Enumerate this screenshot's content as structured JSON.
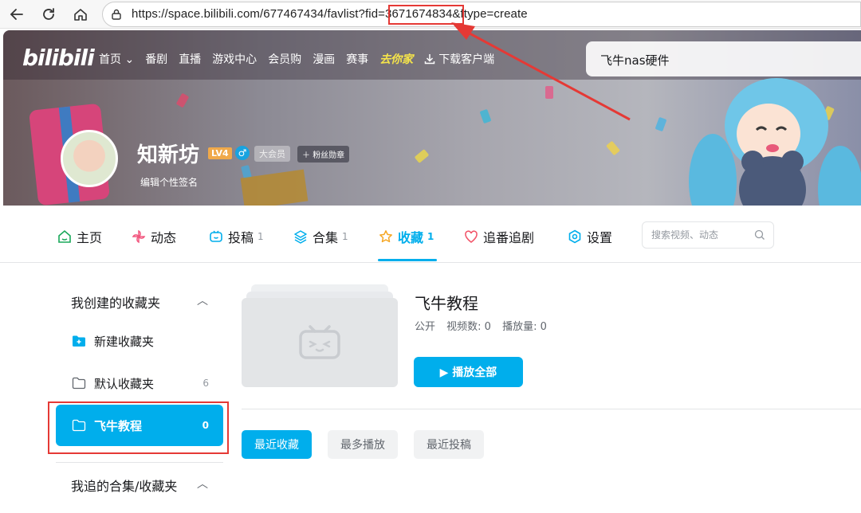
{
  "browser": {
    "url": "https://space.bilibili.com/677467434/favlist?fid=3671674834&ftype=create"
  },
  "header": {
    "logo": "bilibili",
    "nav": [
      "首页 ⌄",
      "番剧",
      "直播",
      "游戏中心",
      "会员购",
      "漫画",
      "赛事"
    ],
    "game_badge": "去你家",
    "download": "下载客户端",
    "search_value": "飞牛nas硬件"
  },
  "profile": {
    "name": "知新坊",
    "level": "LV4",
    "gender": "♂",
    "vip": "大会员",
    "fan_badge": "粉丝勋章",
    "signature": "编辑个性签名"
  },
  "tabs": [
    {
      "label": "主页",
      "count": "",
      "icon": "home-icon"
    },
    {
      "label": "动态",
      "count": "",
      "icon": "pinwheel-icon"
    },
    {
      "label": "投稿",
      "count": "1",
      "icon": "tv-icon"
    },
    {
      "label": "合集",
      "count": "1",
      "icon": "stack-icon"
    },
    {
      "label": "收藏",
      "count": "1",
      "icon": "star-icon"
    },
    {
      "label": "追番追剧",
      "count": "",
      "icon": "heart-icon"
    },
    {
      "label": "设置",
      "count": "",
      "icon": "settings-icon"
    }
  ],
  "space_search": {
    "placeholder": "搜索视频、动态"
  },
  "sidebar": {
    "created_title": "我创建的收藏夹",
    "new_folder": "新建收藏夹",
    "folders": [
      {
        "label": "默认收藏夹",
        "count": "6"
      },
      {
        "label": "飞牛教程",
        "count": "0"
      }
    ],
    "followed_title": "我追的合集/收藏夹"
  },
  "folder": {
    "title": "飞牛教程",
    "visibility": "公开",
    "video_count": "视频数: 0",
    "play_count": "播放量: 0",
    "play_all": "▶ 播放全部"
  },
  "sort_tabs": [
    "最近收藏",
    "最多播放",
    "最近投稿"
  ],
  "colors": {
    "accent": "#00aeec",
    "annotation": "#e53935"
  }
}
